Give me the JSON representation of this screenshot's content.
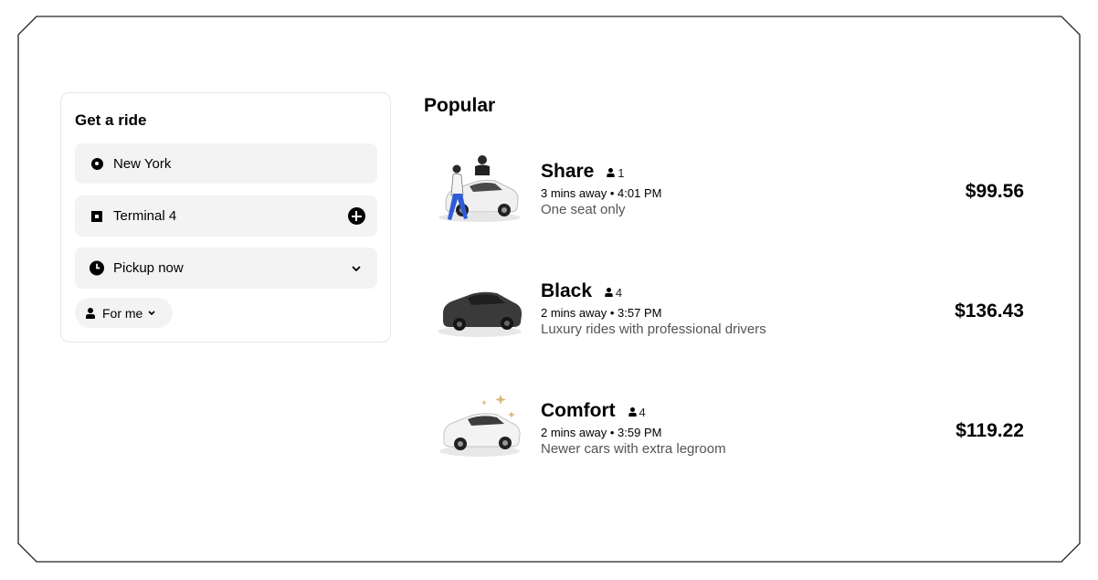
{
  "ride_form": {
    "title": "Get a ride",
    "pickup_value": "New York",
    "dropoff_value": "Terminal 4",
    "time_value": "Pickup now",
    "rider_value": "For me"
  },
  "popular": {
    "title": "Popular",
    "options": [
      {
        "name": "Share",
        "seats": "1",
        "eta": "3 mins away • 4:01 PM",
        "description": "One seat only",
        "price": "$99.56",
        "icon": "car-with-riders-icon"
      },
      {
        "name": "Black",
        "seats": "4",
        "eta": "2 mins away • 3:57 PM",
        "description": "Luxury rides with professional drivers",
        "price": "$136.43",
        "icon": "black-car-icon"
      },
      {
        "name": "Comfort",
        "seats": "4",
        "eta": "2 mins away • 3:59 PM",
        "description": "Newer cars with extra legroom",
        "price": "$119.22",
        "icon": "white-car-sparkle-icon"
      }
    ]
  },
  "colors": {
    "field_bg": "#f3f3f3",
    "secondary_text": "#545454",
    "accent": "#000000"
  }
}
